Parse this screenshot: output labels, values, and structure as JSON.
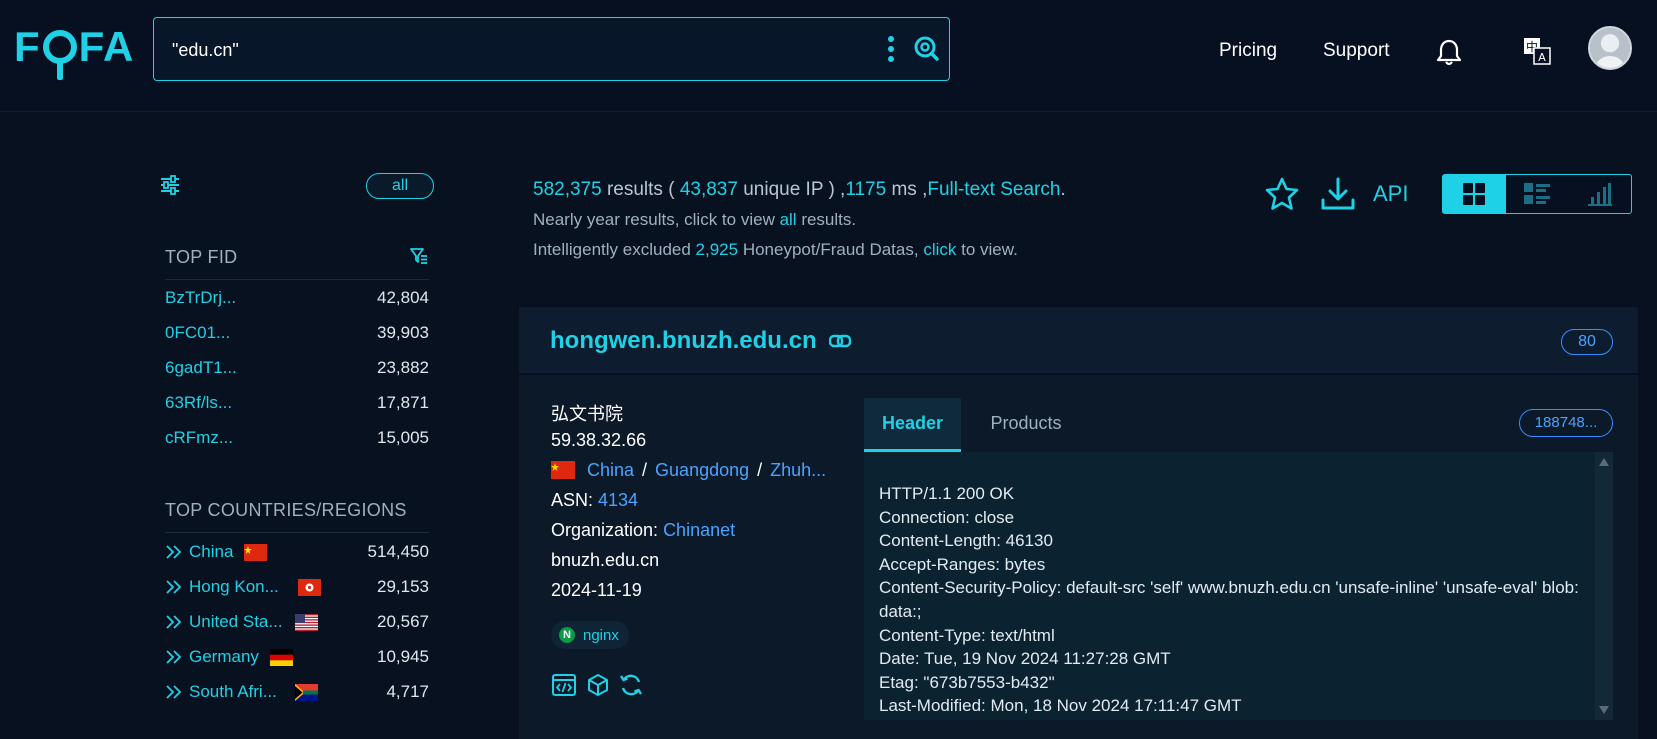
{
  "colors": {
    "accent": "#1fd1e6",
    "link": "#4aa3ff",
    "bg": "#08111f"
  },
  "brand": {
    "logo_text_left": "F",
    "logo_text_right": "FA"
  },
  "search": {
    "query": "\"edu.cn\""
  },
  "nav": {
    "pricing": "Pricing",
    "support": "Support"
  },
  "icons": [
    "options-icon",
    "search-icon",
    "bell-icon",
    "language-icon",
    "avatar",
    "filter-settings-icon",
    "funnel-icon",
    "star-icon",
    "download-icon",
    "link-icon",
    "code-icon",
    "cube-icon",
    "refresh-icon"
  ],
  "sidebar": {
    "all_label": "all",
    "top_fid_heading": "TOP FID",
    "fid_rows": [
      {
        "label": "BzTrDrj...",
        "count": "42,804"
      },
      {
        "label": "0FC01...",
        "count": "39,903"
      },
      {
        "label": "6gadT1...",
        "count": "23,882"
      },
      {
        "label": "63Rf/ls...",
        "count": "17,871"
      },
      {
        "label": "cRFmz...",
        "count": "15,005"
      }
    ],
    "countries_heading": "TOP COUNTRIES/REGIONS",
    "country_rows": [
      {
        "label": "China",
        "count": "514,450",
        "flag": "cn"
      },
      {
        "label": "Hong Kon...",
        "count": "29,153",
        "flag": "hk"
      },
      {
        "label": "United Sta...",
        "count": "20,567",
        "flag": "us"
      },
      {
        "label": "Germany",
        "count": "10,945",
        "flag": "de"
      },
      {
        "label": "South Afri...",
        "count": "4,717",
        "flag": "za"
      }
    ]
  },
  "summary": {
    "results": "582,375",
    "results_word": " results ( ",
    "unique_ip": "43,837",
    "unique_ip_word": " unique IP ) ,",
    "ms": "1175",
    "ms_word": " ms ,",
    "fulltext": "Full-text Search",
    "period": ".",
    "year_prefix": "Nearly year results, click to view ",
    "year_link": "all",
    "year_suffix": " results.",
    "excluded_prefix": "Intelligently excluded ",
    "excluded_count": "2,925",
    "excluded_middle": " Honeypot/Fraud Datas, ",
    "excluded_link": "click",
    "excluded_suffix": " to view."
  },
  "toolbar": {
    "api_label": "API"
  },
  "result": {
    "host": "hongwen.bnuzh.edu.cn",
    "port": "80",
    "title": "弘文书院",
    "ip": "59.38.32.66",
    "country": "China",
    "region": "Guangdong",
    "city": "Zhuh...",
    "location_sep": "/",
    "asn_label": "ASN: ",
    "asn": "4134",
    "org_label": "Organization: ",
    "org": "Chinanet",
    "domain": "bnuzh.edu.cn",
    "date": "2024-11-19",
    "product_tag": "nginx",
    "tabs": {
      "header": "Header",
      "products": "Products"
    },
    "hash_badge": "188748...",
    "header_text": "HTTP/1.1 200 OK\nConnection: close\nContent-Length: 46130\nAccept-Ranges: bytes\nContent-Security-Policy: default-src 'self' www.bnuzh.edu.cn 'unsafe-inline' 'unsafe-eval' blob: data:;\nContent-Type: text/html\nDate: Tue, 19 Nov 2024 11:27:28 GMT\nEtag: \"673b7553-b432\"\nLast-Modified: Mon, 18 Nov 2024 17:11:47 GMT"
  }
}
